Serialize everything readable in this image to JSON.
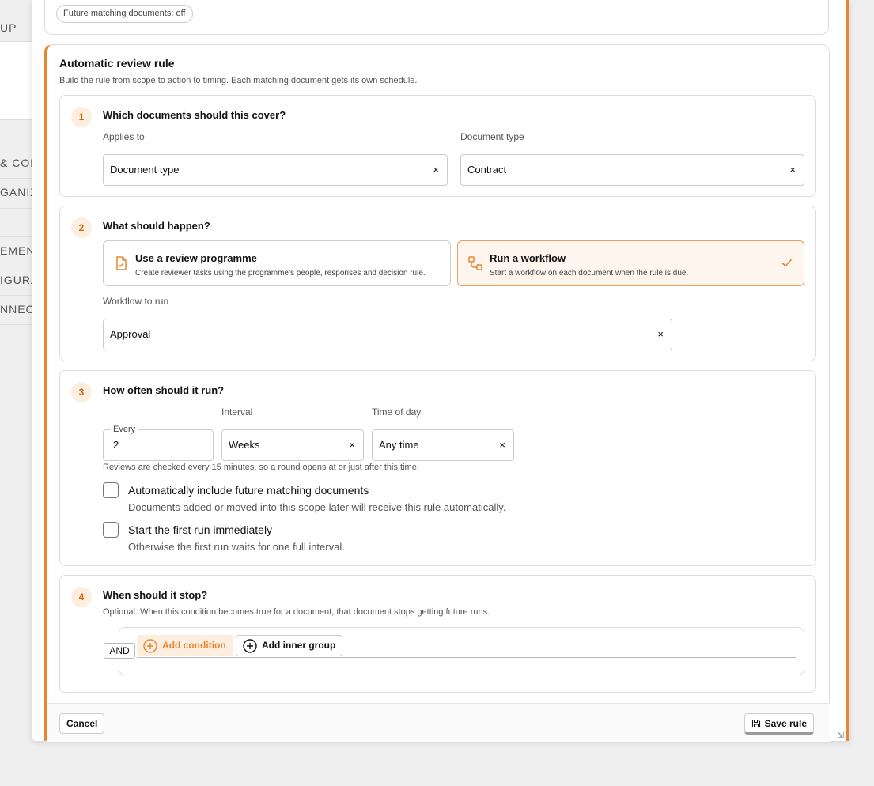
{
  "background": {
    "rows": [
      "UP",
      "& CON",
      "GANIZ",
      "EMENT",
      "IGURA",
      "NNEC"
    ]
  },
  "top": {
    "chip": "Future matching documents: off"
  },
  "rule": {
    "title": "Automatic review rule",
    "subtitle": "Build the rule from scope to action to timing. Each matching document gets its own schedule."
  },
  "step1": {
    "num": "1",
    "title": "Which documents should this cover?",
    "applies_label": "Applies to",
    "applies_value": "Document type",
    "doctype_label": "Document type",
    "doctype_value": "Contract",
    "clear_glyph": "×"
  },
  "step2": {
    "num": "2",
    "title": "What should happen?",
    "options": [
      {
        "title": "Use a review programme",
        "desc": "Create reviewer tasks using the programme’s people, responses and decision rule.",
        "selected": false
      },
      {
        "title": "Run a workflow",
        "desc": "Start a workflow on each document when the rule is due.",
        "selected": true
      }
    ],
    "workflow_label": "Workflow to run",
    "workflow_value": "Approval"
  },
  "step3": {
    "num": "3",
    "title": "How often should it run?",
    "every_label": "Every",
    "every_value": "2",
    "interval_label": "Interval",
    "interval_value": "Weeks",
    "time_label": "Time of day",
    "time_value": "Any time",
    "hint": "Reviews are checked every 15 minutes, so a round opens at or just after this time.",
    "checkboxes": [
      {
        "label": "Automatically include future matching documents",
        "desc": "Documents added or moved into this scope later will receive this rule automatically.",
        "checked": false
      },
      {
        "label": "Start the first run immediately",
        "desc": "Otherwise the first run waits for one full interval.",
        "checked": false
      }
    ]
  },
  "step4": {
    "num": "4",
    "title": "When should it stop?",
    "subtitle": "Optional. When this condition becomes true for a document, that document stops getting future runs.",
    "operator": "AND",
    "add_condition": "Add condition",
    "add_inner_group": "Add inner group"
  },
  "footer": {
    "cancel": "Cancel",
    "save": "Save rule"
  },
  "colors": {
    "accent": "#e8862f",
    "accent_light": "#fdeee0"
  }
}
